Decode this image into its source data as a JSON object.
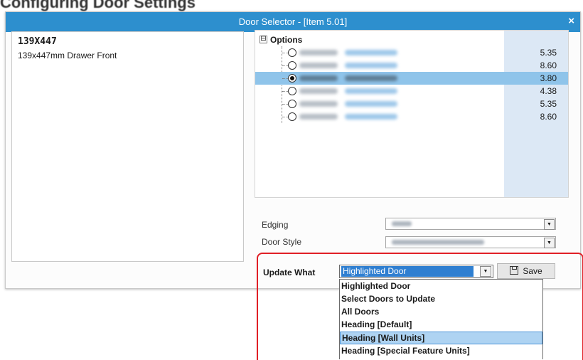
{
  "window": {
    "title": "Door Selector - [Item 5.01]",
    "close_label": "×",
    "accent_color": "#2d8fce"
  },
  "background": {
    "partial_text": "Configuring Door Settings"
  },
  "item": {
    "code": "139X447",
    "description": "139x447mm Drawer Front"
  },
  "options_tree": {
    "root_label": "Options",
    "expander": "⊟",
    "options": [
      {
        "price": "5.35",
        "selected": false
      },
      {
        "price": "8.60",
        "selected": false
      },
      {
        "price": "3.80",
        "selected": true
      },
      {
        "price": "4.38",
        "selected": false
      },
      {
        "price": "5.35",
        "selected": false
      },
      {
        "price": "8.60",
        "selected": false
      }
    ]
  },
  "properties": {
    "edging_label": "Edging",
    "door_style_label": "Door Style"
  },
  "update": {
    "label": "Update What",
    "selected_value": "Highlighted Door",
    "save_label": "Save",
    "highlight_color": "#e01f26",
    "options": [
      "Highlighted Door",
      "Select Doors to Update",
      "All Doors",
      "Heading [Default]",
      "Heading [Wall Units]",
      "Heading [Special Feature Units]"
    ],
    "highlighted_index": 4
  },
  "icons": {
    "dropdown": "▼",
    "save_icon": "floppy-disk-icon"
  }
}
